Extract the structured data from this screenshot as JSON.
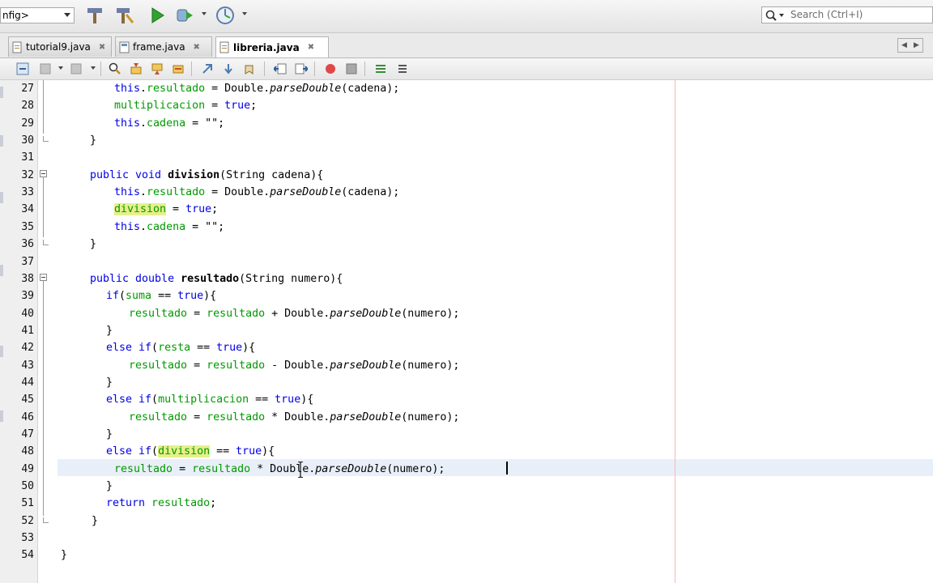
{
  "toolbar": {
    "config_label": "nfig>",
    "search_placeholder": "Search (Ctrl+I)"
  },
  "tabs": [
    {
      "label": "tutorial9.java",
      "active": false
    },
    {
      "label": "frame.java",
      "active": false
    },
    {
      "label": "libreria.java",
      "active": true
    }
  ],
  "colors": {
    "keyword": "#0000e6",
    "field": "#009900",
    "highlight": "#e7f08a",
    "current_line": "#e9eff8"
  },
  "editor": {
    "lines": [
      {
        "num": "27",
        "segs": [
          {
            "t": "this",
            "c": "kw"
          },
          {
            "t": "."
          },
          {
            "t": "resultado",
            "c": "fld"
          },
          {
            "t": " = Double."
          },
          {
            "t": "parseDouble",
            "c": "it"
          },
          {
            "t": "(cadena);"
          }
        ]
      },
      {
        "num": "28",
        "segs": [
          {
            "t": "multiplicacion",
            "c": "fld"
          },
          {
            "t": " = "
          },
          {
            "t": "true",
            "c": "kw"
          },
          {
            "t": ";"
          }
        ]
      },
      {
        "num": "29",
        "segs": [
          {
            "t": "this",
            "c": "kw"
          },
          {
            "t": "."
          },
          {
            "t": "cadena",
            "c": "fld"
          },
          {
            "t": " = \"\";"
          }
        ]
      },
      {
        "num": "30",
        "segs": [
          {
            "t": "}"
          }
        ]
      },
      {
        "num": "31",
        "segs": []
      },
      {
        "num": "32",
        "segs": [
          {
            "t": "public void ",
            "c": "kw"
          },
          {
            "t": "division",
            "c": "b"
          },
          {
            "t": "(String cadena){"
          }
        ]
      },
      {
        "num": "33",
        "segs": [
          {
            "t": "this",
            "c": "kw"
          },
          {
            "t": "."
          },
          {
            "t": "resultado",
            "c": "fld"
          },
          {
            "t": " = Double."
          },
          {
            "t": "parseDouble",
            "c": "it"
          },
          {
            "t": "(cadena);"
          }
        ]
      },
      {
        "num": "34",
        "segs": [
          {
            "t": "division",
            "c": "fld mark"
          },
          {
            "t": " = "
          },
          {
            "t": "true",
            "c": "kw"
          },
          {
            "t": ";"
          }
        ]
      },
      {
        "num": "35",
        "segs": [
          {
            "t": "this",
            "c": "kw"
          },
          {
            "t": "."
          },
          {
            "t": "cadena",
            "c": "fld"
          },
          {
            "t": " = \"\";"
          }
        ]
      },
      {
        "num": "36",
        "segs": [
          {
            "t": "}"
          }
        ]
      },
      {
        "num": "37",
        "segs": []
      },
      {
        "num": "38",
        "segs": [
          {
            "t": "public double ",
            "c": "kw"
          },
          {
            "t": "resultado",
            "c": "b"
          },
          {
            "t": "(String numero){"
          }
        ]
      },
      {
        "num": "39",
        "segs": [
          {
            "t": "if",
            "c": "kw"
          },
          {
            "t": "("
          },
          {
            "t": "suma",
            "c": "fld"
          },
          {
            "t": " == "
          },
          {
            "t": "true",
            "c": "kw"
          },
          {
            "t": "){"
          }
        ]
      },
      {
        "num": "40",
        "segs": [
          {
            "t": "resultado",
            "c": "fld"
          },
          {
            "t": " = "
          },
          {
            "t": "resultado",
            "c": "fld"
          },
          {
            "t": " + Double."
          },
          {
            "t": "parseDouble",
            "c": "it"
          },
          {
            "t": "(numero);"
          }
        ]
      },
      {
        "num": "41",
        "segs": [
          {
            "t": "}"
          }
        ]
      },
      {
        "num": "42",
        "segs": [
          {
            "t": "else if",
            "c": "kw"
          },
          {
            "t": "("
          },
          {
            "t": "resta",
            "c": "fld"
          },
          {
            "t": " == "
          },
          {
            "t": "true",
            "c": "kw"
          },
          {
            "t": "){"
          }
        ]
      },
      {
        "num": "43",
        "segs": [
          {
            "t": "resultado",
            "c": "fld"
          },
          {
            "t": " = "
          },
          {
            "t": "resultado",
            "c": "fld"
          },
          {
            "t": " - Double."
          },
          {
            "t": "parseDouble",
            "c": "it"
          },
          {
            "t": "(numero);"
          }
        ]
      },
      {
        "num": "44",
        "segs": [
          {
            "t": "}"
          }
        ]
      },
      {
        "num": "45",
        "segs": [
          {
            "t": "else if",
            "c": "kw"
          },
          {
            "t": "("
          },
          {
            "t": "multiplicacion",
            "c": "fld"
          },
          {
            "t": " == "
          },
          {
            "t": "true",
            "c": "kw"
          },
          {
            "t": "){"
          }
        ]
      },
      {
        "num": "46",
        "segs": [
          {
            "t": "resultado",
            "c": "fld"
          },
          {
            "t": " = "
          },
          {
            "t": "resultado",
            "c": "fld"
          },
          {
            "t": " * Double."
          },
          {
            "t": "parseDouble",
            "c": "it"
          },
          {
            "t": "(numero);"
          }
        ]
      },
      {
        "num": "47",
        "segs": [
          {
            "t": "}"
          }
        ]
      },
      {
        "num": "48",
        "segs": [
          {
            "t": "else if",
            "c": "kw"
          },
          {
            "t": "("
          },
          {
            "t": "division",
            "c": "fld mark"
          },
          {
            "t": " == "
          },
          {
            "t": "true",
            "c": "kw"
          },
          {
            "t": "){"
          }
        ]
      },
      {
        "num": "49",
        "segs": [
          {
            "t": "resultado",
            "c": "fld"
          },
          {
            "t": " = "
          },
          {
            "t": "resultado",
            "c": "fld"
          },
          {
            "t": " * Double."
          },
          {
            "t": "parseDouble",
            "c": "it"
          },
          {
            "t": "(numero);"
          }
        ]
      },
      {
        "num": "50",
        "segs": [
          {
            "t": "}"
          }
        ]
      },
      {
        "num": "51",
        "segs": [
          {
            "t": "return ",
            "c": "kw"
          },
          {
            "t": "resultado",
            "c": "fld"
          },
          {
            "t": ";"
          }
        ]
      },
      {
        "num": "52",
        "segs": [
          {
            "t": "}"
          }
        ]
      },
      {
        "num": "53",
        "segs": []
      },
      {
        "num": "54",
        "segs": [
          {
            "t": "}"
          }
        ]
      }
    ]
  }
}
